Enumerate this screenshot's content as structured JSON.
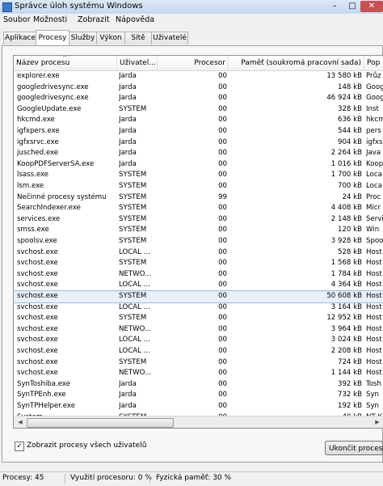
{
  "window": {
    "title": "Správce úloh systému Windows",
    "min": "–",
    "max": "□",
    "close": "✕"
  },
  "menu": [
    "Soubor",
    "Možnosti",
    "Zobrazit",
    "Nápověda"
  ],
  "tabs": [
    {
      "label": "Aplikace",
      "active": false
    },
    {
      "label": "Procesy",
      "active": true
    },
    {
      "label": "Služby",
      "active": false
    },
    {
      "label": "Výkon",
      "active": false
    },
    {
      "label": "Sítě",
      "active": false
    },
    {
      "label": "Uživatelé",
      "active": false
    }
  ],
  "columns": {
    "name": "Název procesu",
    "user": "Uživatel...",
    "cpu": "Procesor",
    "mem": "Paměť (soukromá pracovní sada)",
    "desc": "Pop"
  },
  "sort_indicator": "^",
  "rows": [
    {
      "name": "explorer.exe",
      "user": "Jarda",
      "cpu": "00",
      "mem": "13 580 kB",
      "desc": "Průz"
    },
    {
      "name": "googledrivesync.exe",
      "user": "Jarda",
      "cpu": "00",
      "mem": "148 kB",
      "desc": "Goog"
    },
    {
      "name": "googledrivesync.exe",
      "user": "Jarda",
      "cpu": "00",
      "mem": "46 924 kB",
      "desc": "Goog"
    },
    {
      "name": "GoogleUpdate.exe",
      "user": "SYSTEM",
      "cpu": "00",
      "mem": "328 kB",
      "desc": "Inst"
    },
    {
      "name": "hkcmd.exe",
      "user": "Jarda",
      "cpu": "00",
      "mem": "636 kB",
      "desc": "hkcm"
    },
    {
      "name": "igfxpers.exe",
      "user": "Jarda",
      "cpu": "00",
      "mem": "544 kB",
      "desc": "pers"
    },
    {
      "name": "igfxsrvc.exe",
      "user": "Jarda",
      "cpu": "00",
      "mem": "904 kB",
      "desc": "igfxs"
    },
    {
      "name": "jusched.exe",
      "user": "Jarda",
      "cpu": "00",
      "mem": "2 264 kB",
      "desc": "Java"
    },
    {
      "name": "KoopPDFServerSA.exe",
      "user": "Jarda",
      "cpu": "00",
      "mem": "1 016 kB",
      "desc": "Koop"
    },
    {
      "name": "lsass.exe",
      "user": "SYSTEM",
      "cpu": "00",
      "mem": "1 700 kB",
      "desc": "Loca"
    },
    {
      "name": "lsm.exe",
      "user": "SYSTEM",
      "cpu": "00",
      "mem": "700 kB",
      "desc": "Loca"
    },
    {
      "name": "Nečinné procesy systému",
      "user": "SYSTEM",
      "cpu": "99",
      "mem": "24 kB",
      "desc": "Proc"
    },
    {
      "name": "SearchIndexer.exe",
      "user": "SYSTEM",
      "cpu": "00",
      "mem": "4 408 kB",
      "desc": "Micr"
    },
    {
      "name": "services.exe",
      "user": "SYSTEM",
      "cpu": "00",
      "mem": "2 148 kB",
      "desc": "Servi"
    },
    {
      "name": "smss.exe",
      "user": "SYSTEM",
      "cpu": "00",
      "mem": "120 kB",
      "desc": "Win"
    },
    {
      "name": "spoolsv.exe",
      "user": "SYSTEM",
      "cpu": "00",
      "mem": "3 928 kB",
      "desc": "Spoo"
    },
    {
      "name": "svchost.exe",
      "user": "LOCAL ...",
      "cpu": "00",
      "mem": "528 kB",
      "desc": "Host"
    },
    {
      "name": "svchost.exe",
      "user": "SYSTEM",
      "cpu": "00",
      "mem": "1 568 kB",
      "desc": "Host"
    },
    {
      "name": "svchost.exe",
      "user": "NETWO...",
      "cpu": "00",
      "mem": "1 784 kB",
      "desc": "Host"
    },
    {
      "name": "svchost.exe",
      "user": "LOCAL ...",
      "cpu": "00",
      "mem": "4 364 kB",
      "desc": "Host"
    },
    {
      "name": "svchost.exe",
      "user": "SYSTEM",
      "cpu": "00",
      "mem": "50 608 kB",
      "desc": "Host",
      "selected": true
    },
    {
      "name": "svchost.exe",
      "user": "LOCAL ...",
      "cpu": "00",
      "mem": "3 164 kB",
      "desc": "Host"
    },
    {
      "name": "svchost.exe",
      "user": "SYSTEM",
      "cpu": "00",
      "mem": "12 952 kB",
      "desc": "Host"
    },
    {
      "name": "svchost.exe",
      "user": "NETWO...",
      "cpu": "00",
      "mem": "3 964 kB",
      "desc": "Host"
    },
    {
      "name": "svchost.exe",
      "user": "LOCAL ...",
      "cpu": "00",
      "mem": "3 024 kB",
      "desc": "Host"
    },
    {
      "name": "svchost.exe",
      "user": "LOCAL ...",
      "cpu": "00",
      "mem": "2 208 kB",
      "desc": "Host"
    },
    {
      "name": "svchost.exe",
      "user": "SYSTEM",
      "cpu": "00",
      "mem": "724 kB",
      "desc": "Host"
    },
    {
      "name": "svchost.exe",
      "user": "NETWO...",
      "cpu": "00",
      "mem": "1 144 kB",
      "desc": "Host"
    },
    {
      "name": "SynToshiba.exe",
      "user": "Jarda",
      "cpu": "00",
      "mem": "392 kB",
      "desc": "Tosh"
    },
    {
      "name": "SynTPEnh.exe",
      "user": "Jarda",
      "cpu": "00",
      "mem": "732 kB",
      "desc": "Syn"
    },
    {
      "name": "SynTPHelper.exe",
      "user": "Jarda",
      "cpu": "00",
      "mem": "192 kB",
      "desc": "Syn"
    },
    {
      "name": "System",
      "user": "SYSTEM",
      "cpu": "00",
      "mem": "40 kB",
      "desc": "NT K"
    }
  ],
  "scroll_arrows": {
    "left": "◀",
    "right": "▶"
  },
  "show_all": {
    "label": "Zobrazit procesy všech uživatelů",
    "checked": true,
    "mark": "✓"
  },
  "end_process_button": "Ukončit proces",
  "status": {
    "processes": "Procesy: 45",
    "cpu": "Využití procesoru: 0 %",
    "memory": "Fyzická paměť: 30 %"
  }
}
